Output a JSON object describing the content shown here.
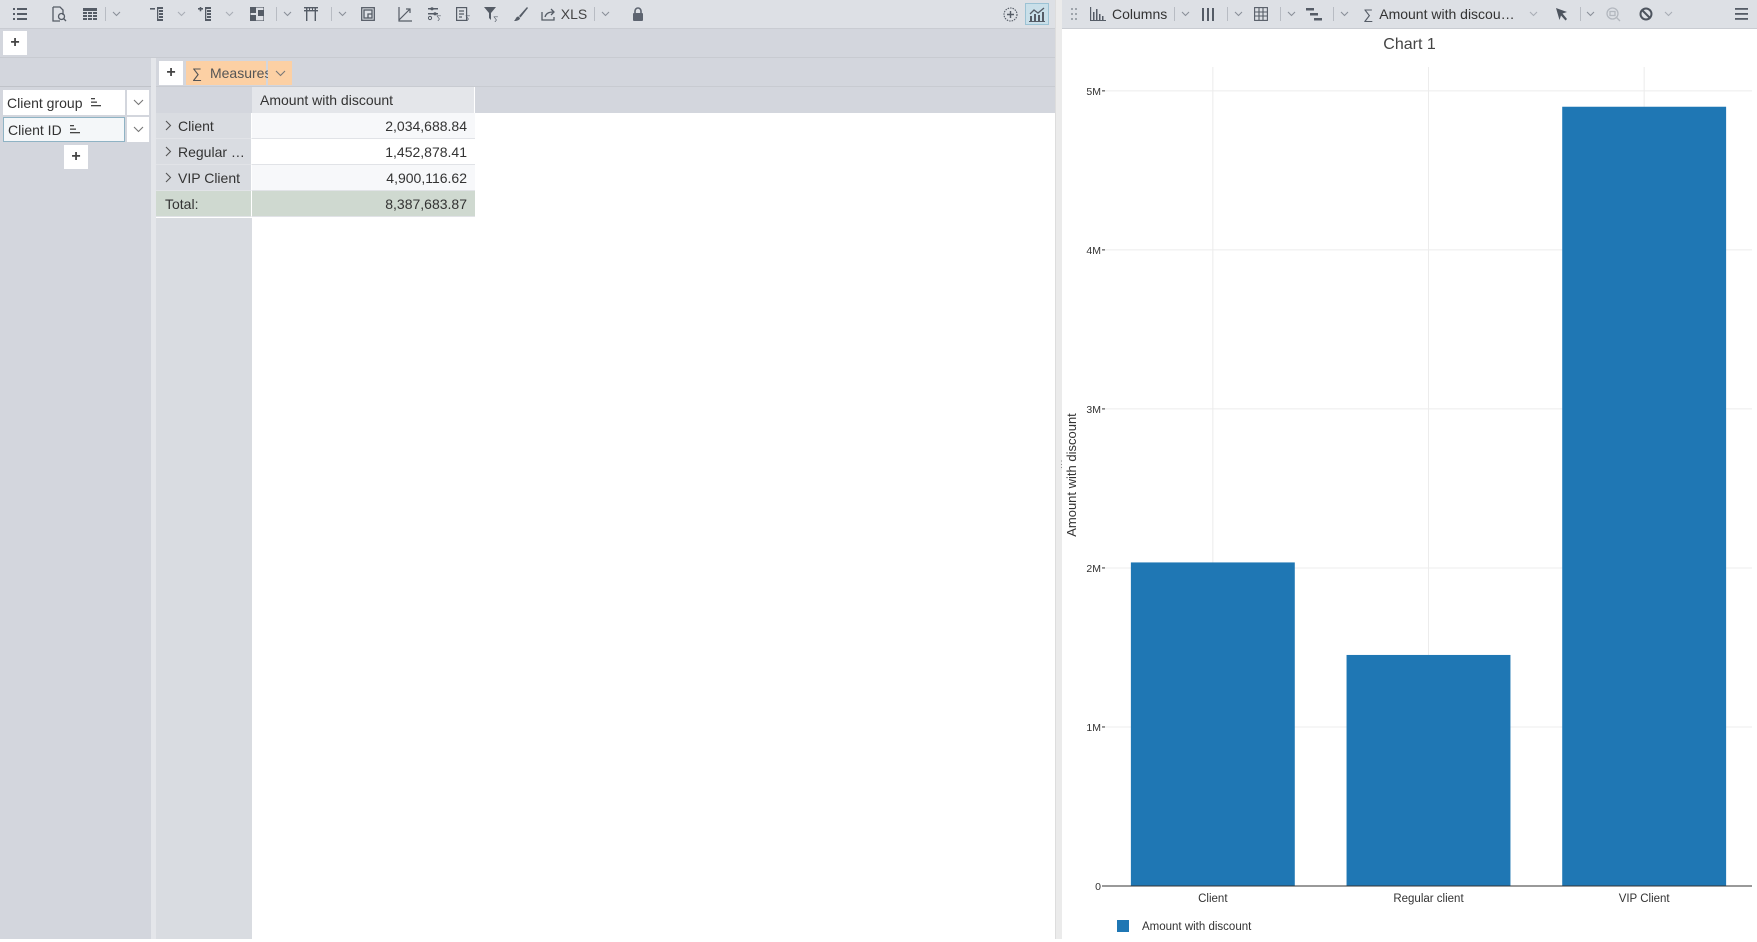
{
  "toolbar_left": {
    "items": [
      {
        "icon": "list-icon"
      },
      {
        "icon": "preview-icon"
      },
      {
        "icon": "table-layout-icon",
        "dropdown": true
      },
      {
        "icon": "collapse-rows-icon",
        "dropdown": true
      },
      {
        "icon": "expand-rows-icon",
        "dropdown": true
      },
      {
        "icon": "grid-layout-icon",
        "dropdown": true
      },
      {
        "icon": "columns-totals-icon",
        "dropdown": true
      },
      {
        "icon": "fit-frame-icon"
      },
      {
        "icon": "axis-icon"
      },
      {
        "icon": "aggregation-settings-icon"
      },
      {
        "icon": "calculated-fields-icon"
      },
      {
        "icon": "filter-sum-icon"
      },
      {
        "icon": "brush-icon"
      },
      {
        "icon": "export-icon",
        "label": "XLS",
        "dropdown": true
      },
      {
        "icon": "lock-icon"
      }
    ],
    "export_label": "XLS",
    "add_chart_icon": "add-circle-icon",
    "chart_toggle_icon": "chart-toggle-icon"
  },
  "toolbar_right": {
    "drag_icon": "drag-handle-icon",
    "chart_type_label": "Columns",
    "measure_label": "Amount with discou…",
    "icons": [
      "bar-chart-icon",
      "stacked-columns-icon",
      "table-icon",
      "legend-icon",
      "sum-icon",
      "pointer-icon",
      "zoom-icon",
      "reset-icon",
      "menu-icon"
    ]
  },
  "pivot": {
    "rows_fields": [
      {
        "label": "Client group",
        "selected": false
      },
      {
        "label": "Client ID",
        "selected": true
      }
    ],
    "measures_label": "Measures",
    "measures_symbol": "∑",
    "column_header": "Amount with discount",
    "rows": [
      {
        "label": "Client",
        "value": "2,034,688.84"
      },
      {
        "label": "Regular …",
        "value": "1,452,878.41"
      },
      {
        "label": "VIP Client",
        "value": "4,900,116.62"
      }
    ],
    "total": {
      "label": "Total:",
      "value": "8,387,683.87"
    },
    "add_label": "+"
  },
  "chart_data": {
    "type": "bar",
    "title": "Chart 1",
    "categories": [
      "Client",
      "Regular client",
      "VIP Client"
    ],
    "series": [
      {
        "name": "Amount with discount",
        "values": [
          2034688.84,
          1452878.41,
          4900116.62
        ],
        "color": "#1f77b4"
      }
    ],
    "xlabel": "",
    "ylabel": "Amount with discount",
    "ylim": [
      0,
      5150000
    ],
    "yticks": [
      0,
      1000000,
      2000000,
      3000000,
      4000000,
      5000000
    ],
    "ytick_labels": [
      "0",
      "1M",
      "2M",
      "3M",
      "4M",
      "5M"
    ],
    "grid": true,
    "legend": "bottom-left"
  }
}
